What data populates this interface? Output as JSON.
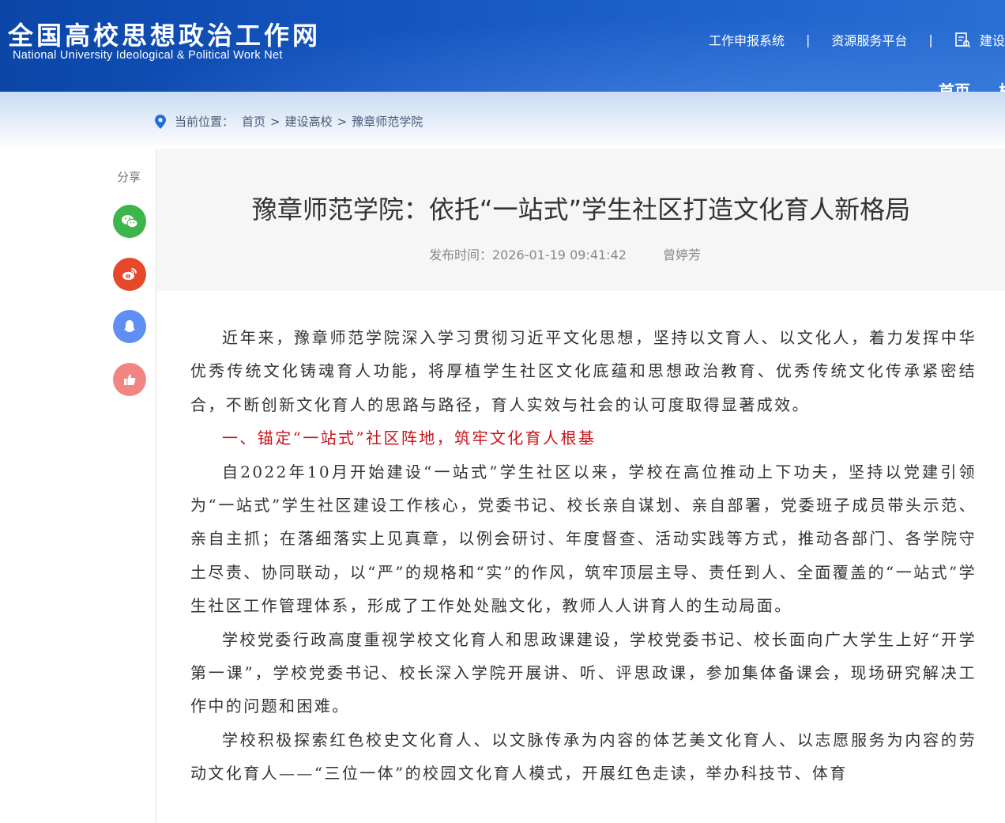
{
  "header": {
    "logo_cn": "全国高校思想政治工作网",
    "logo_en": "National University Ideological & Political Work Net",
    "top_links": [
      "工作申报系统",
      "资源服务平台",
      "建设"
    ],
    "separator": "|",
    "main_nav": [
      "首页",
      "校"
    ]
  },
  "breadcrumb": {
    "label": "当前位置：",
    "items": [
      "首页",
      "建设高校",
      "豫章师范学院"
    ],
    "separator": ">"
  },
  "share": {
    "label": "分享",
    "buttons": [
      {
        "icon": "wechat-icon",
        "color": "#3cb64a"
      },
      {
        "icon": "weibo-icon",
        "color": "#e5492a"
      },
      {
        "icon": "qq-icon",
        "color": "#5f8ff0"
      },
      {
        "icon": "thumbs-up-icon",
        "color": "#f28583"
      }
    ]
  },
  "article": {
    "title": "豫章师范学院：依托“一站式”学生社区打造文化育人新格局",
    "publish_time": "发布时间：2026-01-19 09:41:42",
    "author": "曾婷芳",
    "paragraphs": [
      "近年来，豫章师范学院深入学习贯彻习近平文化思想，坚持以文育人、以文化人，着力发挥中华优秀传统文化铸魂育人功能，将厚植学生社区文化底蕴和思想政治教育、优秀传统文化传承紧密结合，不断创新文化育人的思路与路径，育人实效与社会的认可度取得显著成效。",
      "一、锚定“一站式”社区阵地，筑牢文化育人根基",
      "自2022年10月开始建设“一站式”学生社区以来，学校在高位推动上下功夫，坚持以党建引领为“一站式”学生社区建设工作核心，党委书记、校长亲自谋划、亲自部署，党委班子成员带头示范、亲自主抓；在落细落实上见真章，以例会研讨、年度督查、活动实践等方式，推动各部门、各学院守土尽责、协同联动，以“严”的规格和“实”的作风，筑牢顶层主导、责任到人、全面覆盖的“一站式”学生社区工作管理体系，形成了工作处处融文化，教师人人讲育人的生动局面。",
      "学校党委行政高度重视学校文化育人和思政课建设，学校党委书记、校长面向广大学生上好“开学第一课”，学校党委书记、校长深入学院开展讲、听、评思政课，参加集体备课会，现场研究解决工作中的问题和困难。",
      "学校积极探索红色校史文化育人、以文脉传承为内容的体艺美文化育人、以志愿服务为内容的劳动文化育人——“三位一体”的校园文化育人模式，开展红色走读，举办科技节、体育"
    ],
    "heading_color": "#c8141b"
  },
  "colors": {
    "header_blue": "#1456c0",
    "crumb_pin": "#1e6fd9"
  }
}
